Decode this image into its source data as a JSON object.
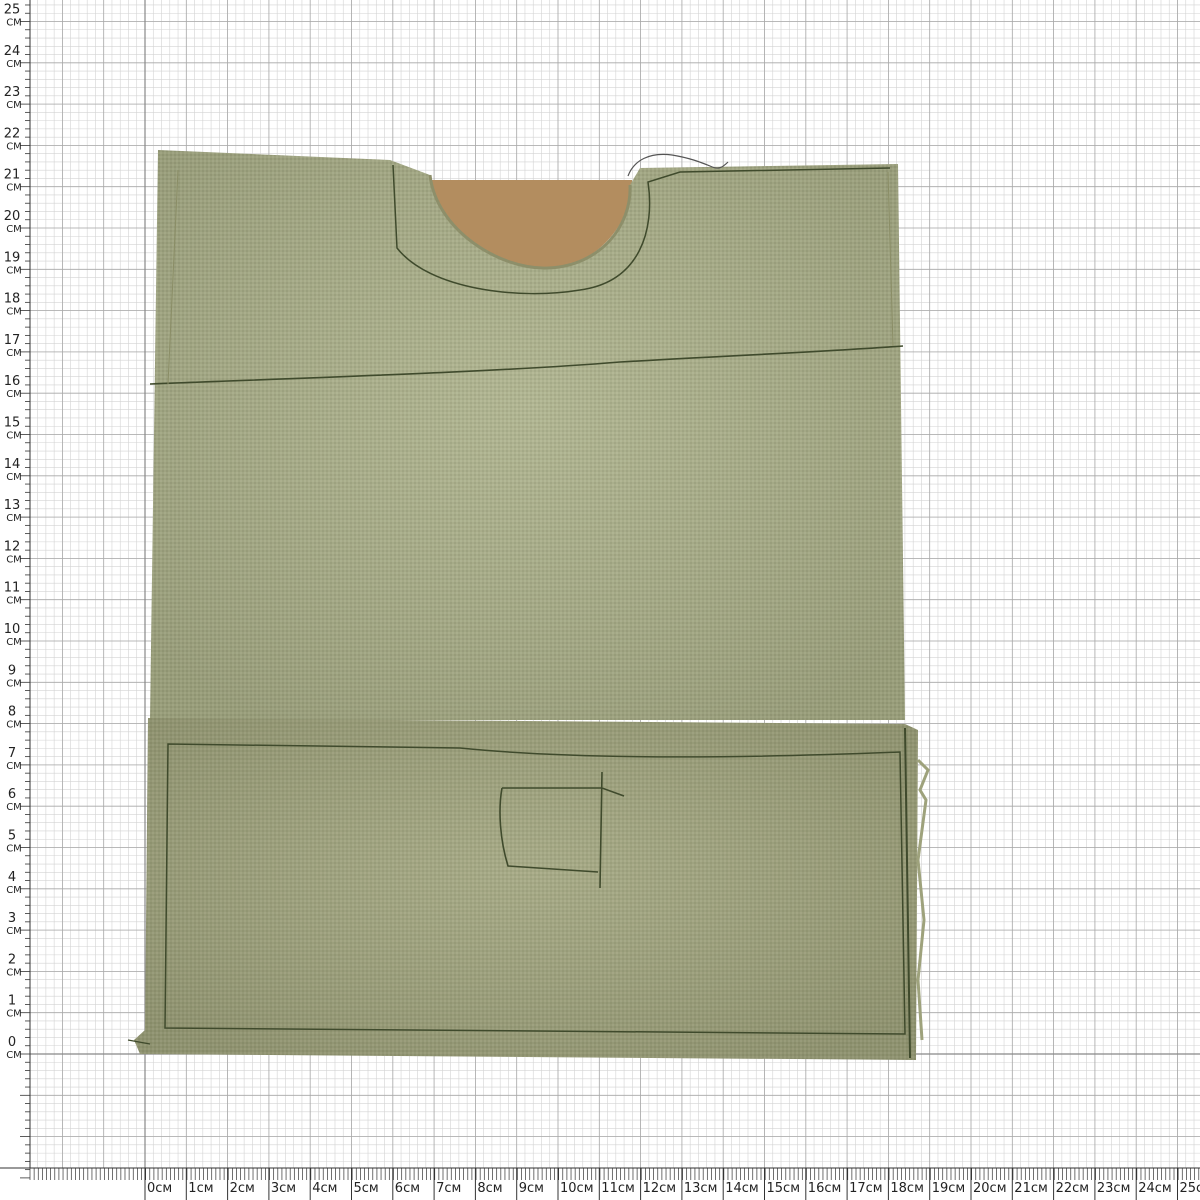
{
  "ruler": {
    "vertical_labels": [
      "0",
      "1",
      "2",
      "3",
      "4",
      "5",
      "6",
      "7",
      "8",
      "9",
      "10",
      "11",
      "12",
      "13",
      "14",
      "15",
      "16",
      "17",
      "18",
      "19",
      "20",
      "21",
      "22",
      "23",
      "24",
      "25"
    ],
    "vertical_unit": "СМ",
    "horizontal_labels": [
      "0см",
      "1см",
      "2см",
      "3см",
      "4см",
      "5см",
      "6см",
      "7см",
      "8см",
      "9см",
      "10см",
      "11см",
      "12см",
      "13см",
      "14см",
      "15см",
      "16см",
      "17см",
      "18см",
      "19см",
      "20см",
      "21см",
      "22см",
      "23см",
      "24см",
      "25с"
    ]
  },
  "colors": {
    "grid_minor": "#d3d3d3",
    "grid_major": "#a9a9a9",
    "axis_line": "#888888",
    "fabric": "#a7ad86",
    "fabric_dark": "#969b77",
    "fabric_lining": "#b08c5e",
    "stitch": "#3f4a2c"
  },
  "object": {
    "name": "khaki canvas pouch with neck cut-out and front pocket"
  }
}
